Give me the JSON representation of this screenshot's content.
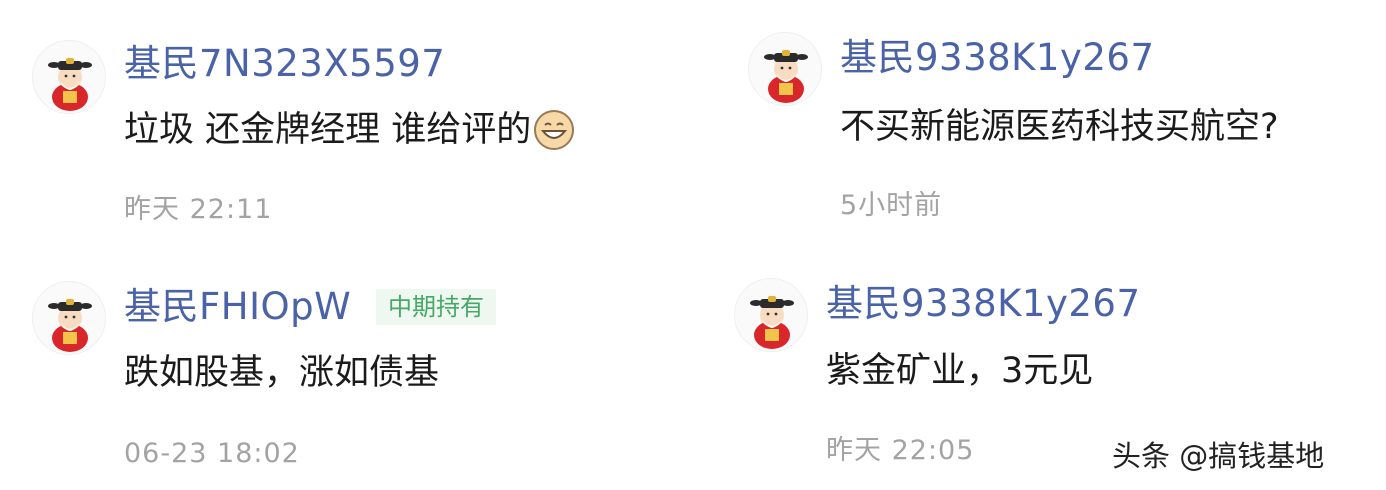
{
  "comments": [
    {
      "avatar_icon": "fortune-god-avatar-icon",
      "username": "基民7N323X5597",
      "badge": "",
      "content": "垃圾 还金牌经理 谁给评的",
      "content_emoji": "grinning-face-icon",
      "time": "昨天 22:11"
    },
    {
      "avatar_icon": "fortune-god-avatar-icon",
      "username": "基民9338K1y267",
      "badge": "",
      "content": "不买新能源医药科技买航空?",
      "time": "5小时前"
    },
    {
      "avatar_icon": "fortune-god-avatar-icon",
      "username": "基民FHIOpW",
      "badge": "中期持有",
      "content": "跌如股基，涨如债基",
      "time": "06-23 18:02"
    },
    {
      "avatar_icon": "fortune-god-avatar-icon",
      "username": "基民9338K1y267",
      "badge": "",
      "content": "紫金矿业，3元见",
      "time": "昨天 22:05"
    }
  ],
  "watermark": "头条 @搞钱基地",
  "colors": {
    "username": "#4a63a8",
    "content": "#1b1b1b",
    "time": "#a3a3a3",
    "badge_text": "#48a867",
    "badge_bg": "#eef7f0"
  }
}
